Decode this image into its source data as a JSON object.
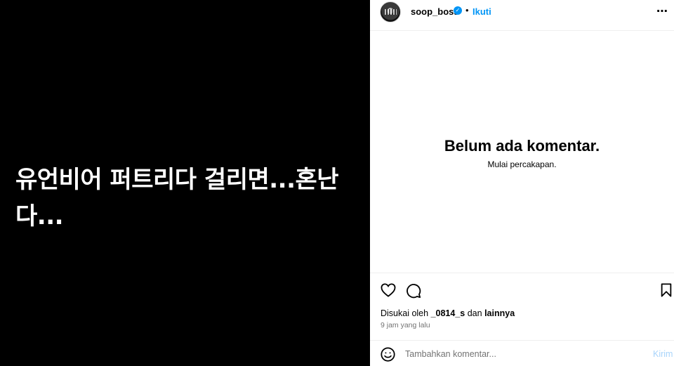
{
  "post": {
    "caption_overlay_line1": "유언비어 퍼트리다 걸리면...혼난",
    "caption_overlay_line2": "다..."
  },
  "header": {
    "username": "soop_boss",
    "separator": "•",
    "follow_label": "Ikuti",
    "more_label": "⋯"
  },
  "comments": {
    "empty_title": "Belum ada komentar.",
    "empty_subtitle": "Mulai percakapan."
  },
  "likes": {
    "prefix": "Disukai oleh",
    "user": "_0814_s",
    "connector": "dan",
    "others": "lainnya"
  },
  "timestamp": "9 jam yang lalu",
  "comment_box": {
    "placeholder": "Tambahkan komentar...",
    "post_label": "Kirim"
  },
  "icons": {
    "like": "heart-icon",
    "comment": "comment-icon",
    "save": "bookmark-icon",
    "emoji": "smiley-icon",
    "verified": "verified-badge-icon"
  },
  "colors": {
    "accent": "#0095f6",
    "post_disabled": "#a8d4fb",
    "secondary_text": "#737373",
    "media_bg": "#000000"
  }
}
